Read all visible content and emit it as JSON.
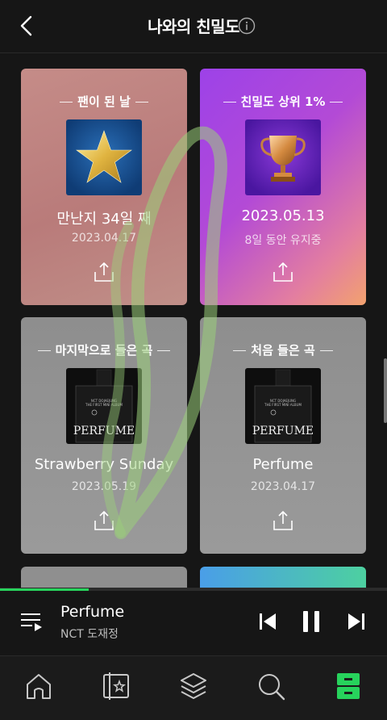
{
  "header": {
    "title": "나와의 친밀도"
  },
  "cards": [
    {
      "title": "팬이 된 날",
      "main": "만난지 34일 째",
      "sub": "2023.04.17",
      "cover_icon": "star-icon"
    },
    {
      "title": "친밀도 상위 1%",
      "main": "2023.05.13",
      "sub": "8일 동안 유지중",
      "cover_icon": "trophy-icon"
    },
    {
      "title": "마지막으로 들은 곡",
      "main": "Strawberry Sunday",
      "sub": "2023.05.19",
      "cover_text": "PERFUME",
      "cover_small": "NCT DOJAEJUNG\nTHE FIRST MINI ALBUM"
    },
    {
      "title": "처음 들은 곡",
      "main": "Perfume",
      "sub": "2023.04.17",
      "cover_text": "PERFUME",
      "cover_small": "NCT DOJAEJUNG\nTHE FIRST MINI ALBUM"
    }
  ],
  "player": {
    "title": "Perfume",
    "artist": "NCT 도재정",
    "progress": 0.23
  },
  "tabs": [
    "home-icon",
    "library-icon",
    "stack-icon",
    "search-icon",
    "storage-icon"
  ],
  "colors": {
    "accent": "#27d35c",
    "background": "#161616",
    "overlay_stroke": "#9bd07a"
  }
}
